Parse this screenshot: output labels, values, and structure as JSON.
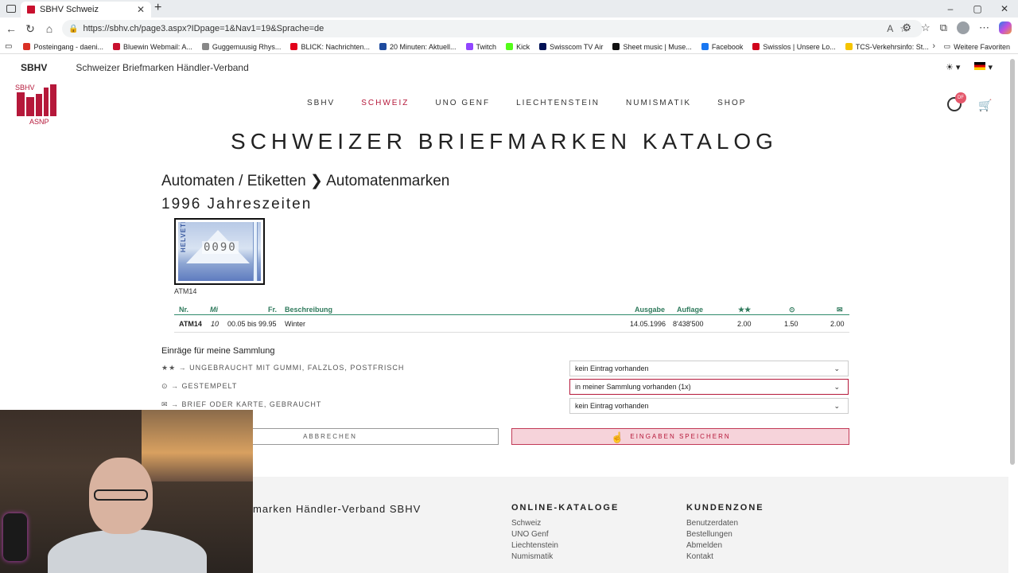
{
  "browser": {
    "tab_title": "SBHV Schweiz",
    "url": "https://sbhv.ch/page3.aspx?IDpage=1&Nav1=19&Sprache=de",
    "bookmarks": [
      {
        "label": "Posteingang - daeni...",
        "color": "#d93025"
      },
      {
        "label": "Bluewin Webmail: A...",
        "color": "#c8102e"
      },
      {
        "label": "Guggemuusig Rhys...",
        "color": "#888888"
      },
      {
        "label": "BLICK: Nachrichten...",
        "color": "#e2001a"
      },
      {
        "label": "20 Minuten: Aktuell...",
        "color": "#1e4b9e"
      },
      {
        "label": "Twitch",
        "color": "#9146ff"
      },
      {
        "label": "Kick",
        "color": "#53fc18"
      },
      {
        "label": "Swisscom TV Air",
        "color": "#001155"
      },
      {
        "label": "Sheet music | Muse...",
        "color": "#111111"
      },
      {
        "label": "Facebook",
        "color": "#1877f2"
      },
      {
        "label": "Swisslos | Unsere Lo...",
        "color": "#d0021b"
      },
      {
        "label": "TCS-Verkehrsinfo: St...",
        "color": "#f5c400"
      }
    ],
    "more_favorites": "Weitere Favoriten"
  },
  "site": {
    "brand": "SBHV",
    "fullname": "Schweizer Briefmarken Händler-Verband",
    "logo_text_top": "SBHV",
    "logo_text_bottom": "ASNP",
    "account_badge": "DF",
    "nav": [
      "SBHV",
      "SCHWEIZ",
      "UNO GENF",
      "LIECHTENSTEIN",
      "NUMISMATIK",
      "SHOP"
    ],
    "accent": "#b5183a"
  },
  "page": {
    "title": "SCHWEIZER BRIEFMARKEN KATALOG",
    "breadcrumb": "Automaten / Etiketten ❯ Automatenmarken",
    "subtitle": "1996 Jahreszeiten",
    "stamp_label": "ATM14",
    "stamp_value": "0090",
    "stamp_country": "HELVETIA"
  },
  "table": {
    "headers": {
      "nr": "Nr.",
      "mi": "Mi",
      "fr": "Fr.",
      "desc": "Beschreibung",
      "ausgabe": "Ausgabe",
      "auflage": "Auflage",
      "mint": "★★",
      "used": "⊙",
      "cover": "✉"
    },
    "row": {
      "nr": "ATM14",
      "mi": "10",
      "fr": "00.05 bis 99.95",
      "desc": "Winter",
      "ausgabe": "14.05.1996",
      "auflage": "8'438'500",
      "mint": "2.00",
      "used": "1.50",
      "cover": "2.00"
    }
  },
  "collection": {
    "title": "Einräge für meine Sammlung",
    "items": [
      {
        "label": "★★ → UNGEBRAUCHT MIT GUMMI, FALZLOS, POSTFRISCH",
        "value": "kein Eintrag vorhanden"
      },
      {
        "label": "⊙ → GESTEMPELT",
        "value": "in meiner Sammlung vorhanden (1x)"
      },
      {
        "label": "✉ → BRIEF ODER KARTE, GEBRAUCHT",
        "value": "kein Eintrag vorhanden"
      }
    ],
    "cancel": "ABBRECHEN",
    "save": "EINGABEN SPEICHERN"
  },
  "footer": {
    "org": "marken Händler-Verband SBHV",
    "col1": {
      "heading": "ONLINE-KATALOGE",
      "links": [
        "Schweiz",
        "UNO Genf",
        "Liechtenstein",
        "Numismatik"
      ]
    },
    "col2": {
      "heading": "KUNDENZONE",
      "links": [
        "Benutzerdaten",
        "Bestellungen",
        "Abmelden",
        "Kontakt"
      ]
    }
  }
}
